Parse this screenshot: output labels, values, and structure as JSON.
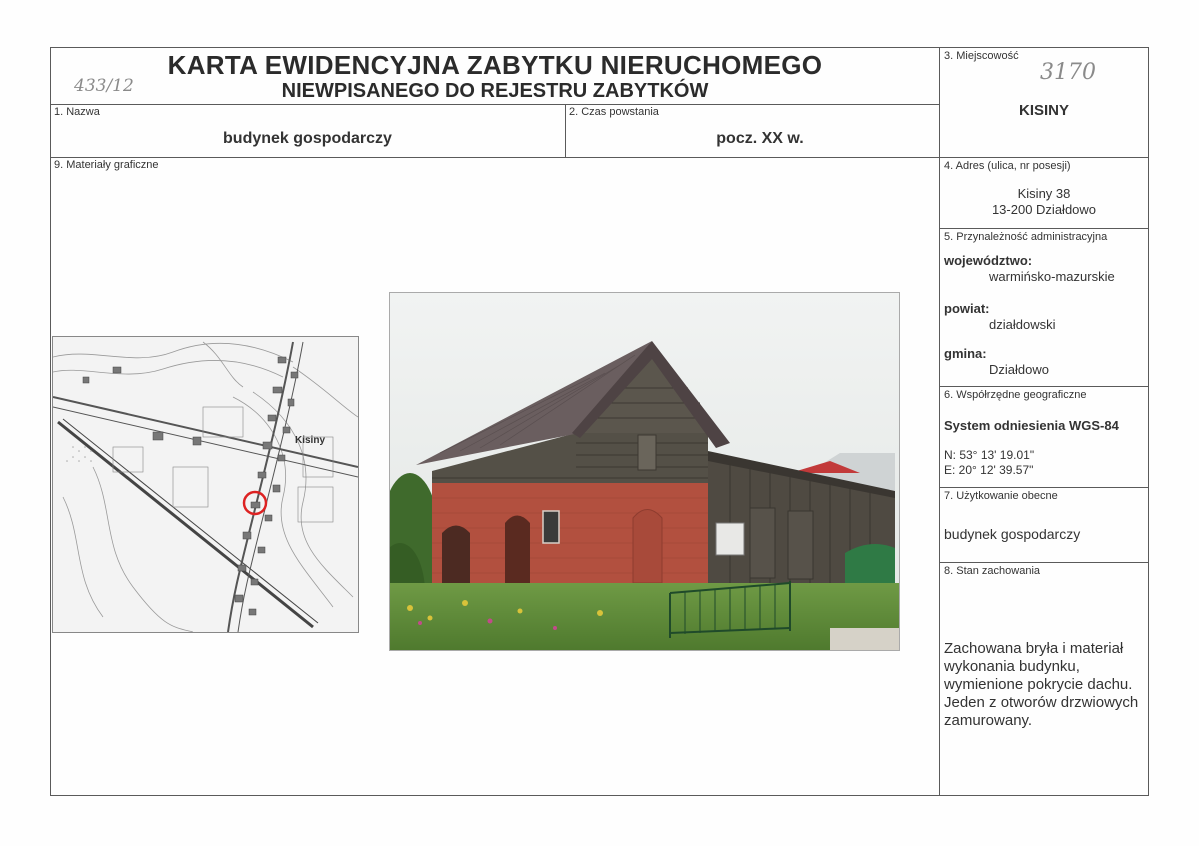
{
  "header": {
    "title_line1": "KARTA EWIDENCYJNA ZABYTKU NIERUCHOMEGO",
    "title_line2": "NIEWPISANEGO DO REJESTRU ZABYTKÓW",
    "handwritten_left": "433/12",
    "handwritten_right": "3170"
  },
  "fields": {
    "nazwa": {
      "label": "1. Nazwa",
      "value": "budynek gospodarczy"
    },
    "czas": {
      "label": "2. Czas powstania",
      "value": "pocz. XX w."
    },
    "miejscowosc": {
      "label": "3. Miejscowość",
      "value": "KISINY"
    },
    "adres": {
      "label": "4. Adres (ulica, nr posesji)",
      "line1": "Kisiny 38",
      "line2": "13-200 Działdowo"
    },
    "admin": {
      "label": "5. Przynależność administracyjna",
      "woj_label": "województwo:",
      "woj_value": "warmińsko-mazurskie",
      "pow_label": "powiat:",
      "pow_value": "działdowski",
      "gmina_label": "gmina:",
      "gmina_value": "Działdowo"
    },
    "wsp": {
      "label": "6. Współrzędne geograficzne",
      "system": "System odniesienia WGS-84",
      "n": "N: 53° 13' 19.01\"",
      "e": "E: 20° 12' 39.57\""
    },
    "uzytkowanie": {
      "label": "7. Użytkowanie obecne",
      "value": "budynek gospodarczy"
    },
    "stan": {
      "label": "8. Stan zachowania",
      "value": "Zachowana bryła i materiał wykonania budynku, wymienione pokrycie dachu. Jeden z otworów drzwiowych zamurowany."
    },
    "materialy": {
      "label": "9. Materiały graficzne"
    }
  },
  "map": {
    "place_label": "Kisiny"
  }
}
